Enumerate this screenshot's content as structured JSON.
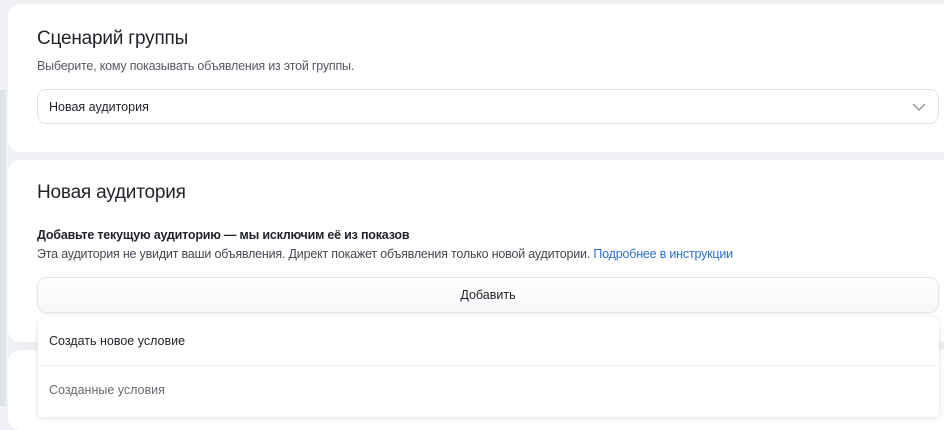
{
  "scenario": {
    "title": "Сценарий группы",
    "subtitle": "Выберите, кому показывать объявления из этой группы.",
    "select_value": "Новая аудитория"
  },
  "audience": {
    "title": "Новая аудитория",
    "bold_text": "Добавьте текущую аудиторию — мы исключим её из показов",
    "description": "Эта аудитория не увидит ваши объявления. Директ покажет объявления только новой аудитории. ",
    "link": "Подробнее в инструкции",
    "add_button": "Добавить"
  },
  "menu": {
    "items": [
      "Создать новое условие",
      "Созданные условия"
    ]
  }
}
